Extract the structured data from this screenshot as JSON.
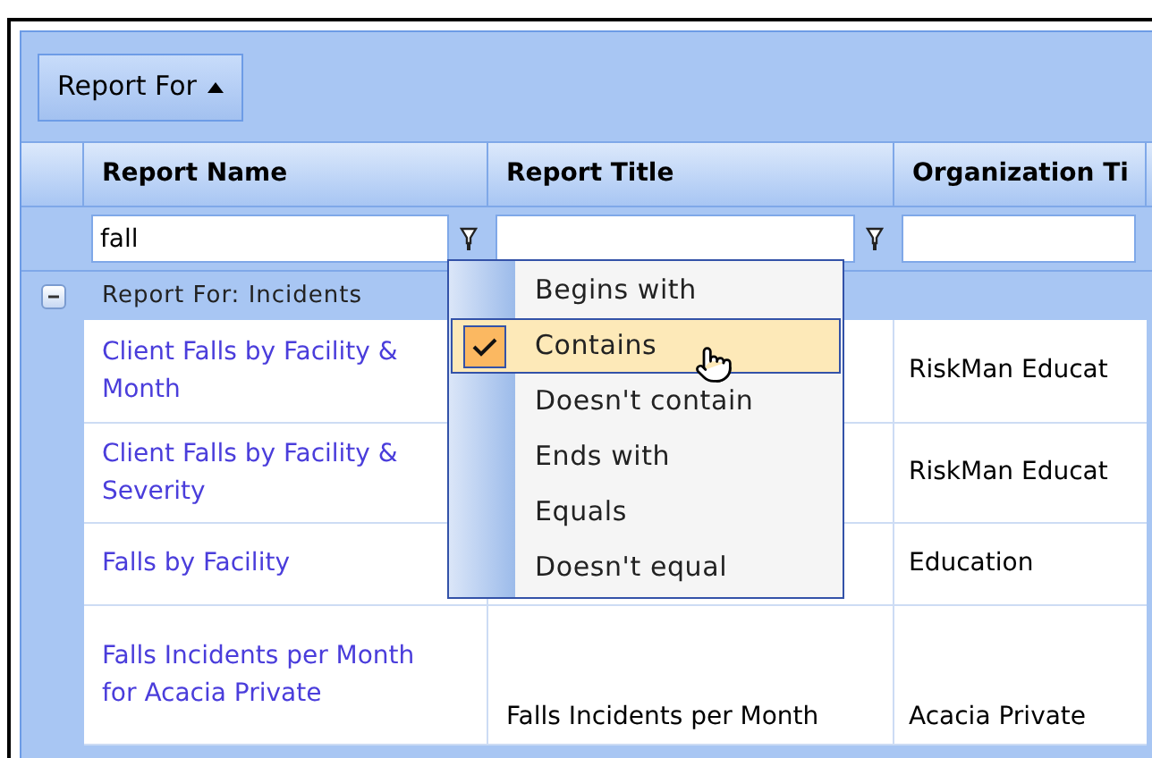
{
  "toolbar": {
    "group_button": "Report For"
  },
  "columns": [
    "Report Name",
    "Report Title",
    "Organization Ti"
  ],
  "filters": [
    {
      "value": "fall",
      "funnel": true
    },
    {
      "funnel": true
    },
    {
      "funnel": false
    }
  ],
  "group": {
    "label": "Report For: Incidents",
    "expanded": true
  },
  "rows": [
    {
      "name": "Client Falls by Facility & Month",
      "org": "RiskMan Educat"
    },
    {
      "name": "Client Falls by Facility & Severity",
      "org": "RiskMan Educat"
    },
    {
      "name": "Falls by Facility",
      "org": "Education"
    },
    {
      "name": "Falls Incidents per Month for Acacia Private",
      "title": "Falls Incidents per Month",
      "org": "Acacia Private"
    }
  ],
  "filter_menu": [
    {
      "label": "Begins with",
      "selected": false
    },
    {
      "label": "Contains",
      "selected": true
    },
    {
      "label": "Doesn't contain",
      "selected": false
    },
    {
      "label": "Ends with",
      "selected": false
    },
    {
      "label": "Equals",
      "selected": false
    },
    {
      "label": "Doesn't equal",
      "selected": false
    }
  ]
}
